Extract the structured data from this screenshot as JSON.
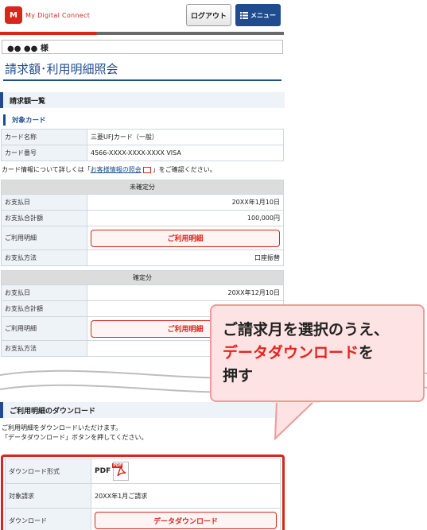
{
  "header": {
    "logo_mark": "M",
    "logo_text": "My Digital Connect",
    "logout_label": "ログアウト",
    "menu_icon": "hamburger-icon",
    "menu_label": "メニュー"
  },
  "user": {
    "name": "●● ●● 様"
  },
  "page": {
    "title": "請求額･利用明細照会"
  },
  "billing": {
    "section_title": "請求額一覧",
    "card_subsection": "対象カード",
    "card_rows": [
      {
        "label": "カード名称",
        "value": "三菱UFJカード（一般）"
      },
      {
        "label": "カード番号",
        "value": "4566-XXXX-XXXX-XXXX VISA"
      }
    ],
    "note_prefix": "カード情報について詳しくは「",
    "note_link": "お客様情報の照会",
    "note_suffix": "」をご確認ください。",
    "unconfirmed": {
      "caption": "未確定分",
      "pay_date_label": "お支払日",
      "pay_date": "20XX年1月10日",
      "total_label": "お支払合計額",
      "total": "100,000円",
      "detail_label": "ご利用明細",
      "detail_button": "ご利用明細",
      "method_label": "お支払方法",
      "method": "口座振替"
    },
    "confirmed": {
      "caption": "確定分",
      "pay_date_label": "お支払日",
      "pay_date": "20XX年12月10日",
      "total_label": "お支払合計額",
      "detail_label": "ご利用明細",
      "detail_button": "ご利用明細",
      "method_label": "お支払方法"
    }
  },
  "download": {
    "section_title": "ご利用明細のダウンロード",
    "text_line1": "ご利用明細をダウンロードいただけます。",
    "text_line2": "「データダウンロード」ボタンを押してください。",
    "format_label": "ダウンロード形式",
    "format_value": "PDF",
    "format_icon": "pdf-file-icon",
    "pdf_tag": "PDF",
    "target_label": "対象請求",
    "target_value": "20XX年1月ご請求",
    "action_label": "ダウンロード",
    "button_label": "データダウンロード"
  },
  "callout": {
    "line1": "ご請求月を選択のうえ、",
    "line2_red": "データダウンロード",
    "line2_rest": "を",
    "line3": "押す"
  },
  "colors": {
    "brand_red": "#d9261c",
    "navy": "#1f4c8f",
    "callout_bg": "#fde3e3"
  }
}
